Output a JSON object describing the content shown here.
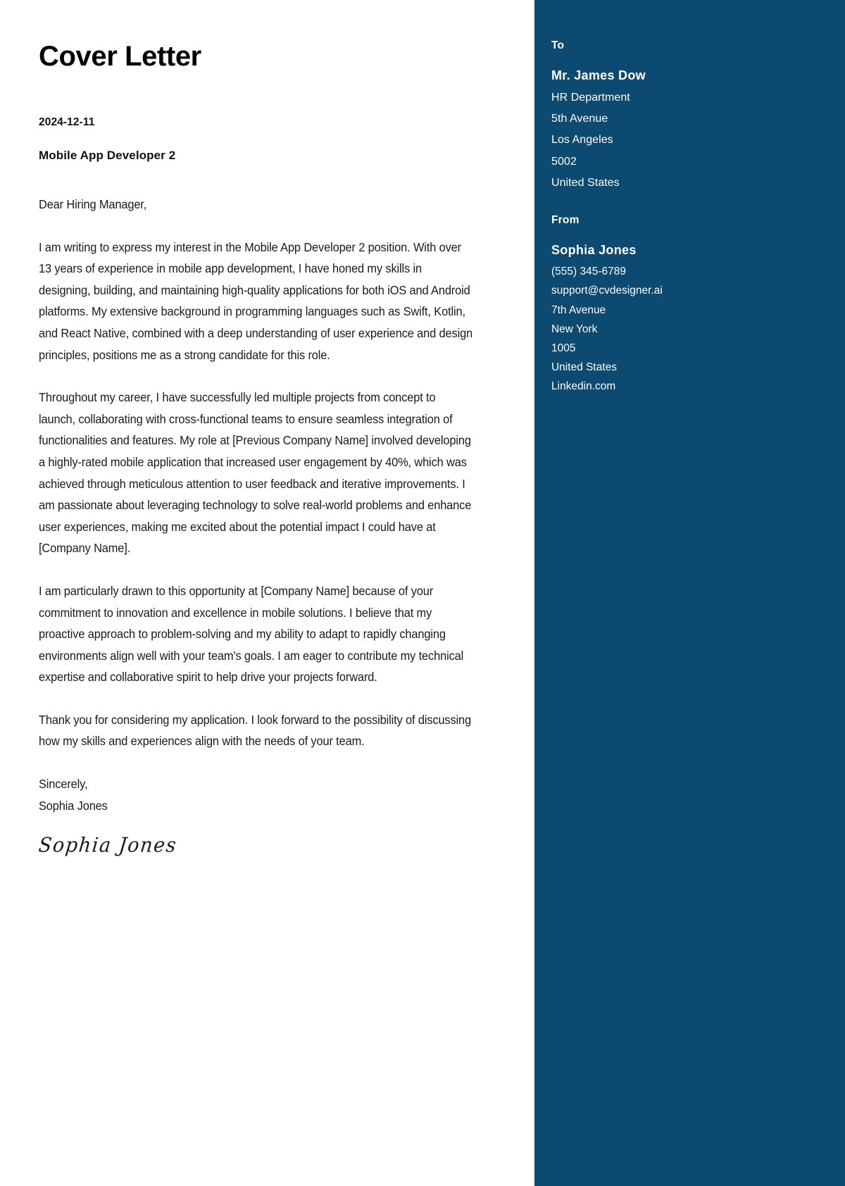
{
  "document": {
    "title": "Cover Letter",
    "date": "2024-12-11",
    "position": "Mobile App Developer 2",
    "salutation": "Dear Hiring Manager,",
    "paragraphs": [
      "I am writing to express my interest in the Mobile App Developer 2 position. With over 13 years of experience in mobile app development, I have honed my skills in designing, building, and maintaining high-quality applications for both iOS and Android platforms. My extensive background in programming languages such as Swift, Kotlin, and React Native, combined with a deep understanding of user experience and design principles, positions me as a strong candidate for this role.",
      "Throughout my career, I have successfully led multiple projects from concept to launch, collaborating with cross-functional teams to ensure seamless integration of functionalities and features. My role at [Previous Company Name] involved developing a highly-rated mobile application that increased user engagement by 40%, which was achieved through meticulous attention to user feedback and iterative improvements. I am passionate about leveraging technology to solve real-world problems and enhance user experiences, making me excited about the potential impact I could have at [Company Name].",
      "I am particularly drawn to this opportunity at [Company Name] because of your commitment to innovation and excellence in mobile solutions. I believe that my proactive approach to problem-solving and my ability to adapt to rapidly changing environments align well with your team's goals. I am eager to contribute my technical expertise and collaborative spirit to help drive your projects forward.",
      "Thank you for considering my application. I look forward to the possibility of discussing how my skills and experiences align with the needs of your team."
    ],
    "closing_word": "Sincerely,",
    "closing_name": "Sophia Jones",
    "signature": "Sophia Jones"
  },
  "sidebar": {
    "background_color": "#0d4a72",
    "to": {
      "heading": "To",
      "name": "Mr. James Dow",
      "lines": [
        "HR Department",
        "5th Avenue",
        "Los Angeles",
        "5002",
        "United States"
      ]
    },
    "from": {
      "heading": "From",
      "name": "Sophia Jones",
      "lines": [
        "(555) 345-6789",
        "support@cvdesigner.ai",
        "7th Avenue",
        "New York",
        "1005",
        "United States",
        "Linkedin.com"
      ]
    }
  }
}
